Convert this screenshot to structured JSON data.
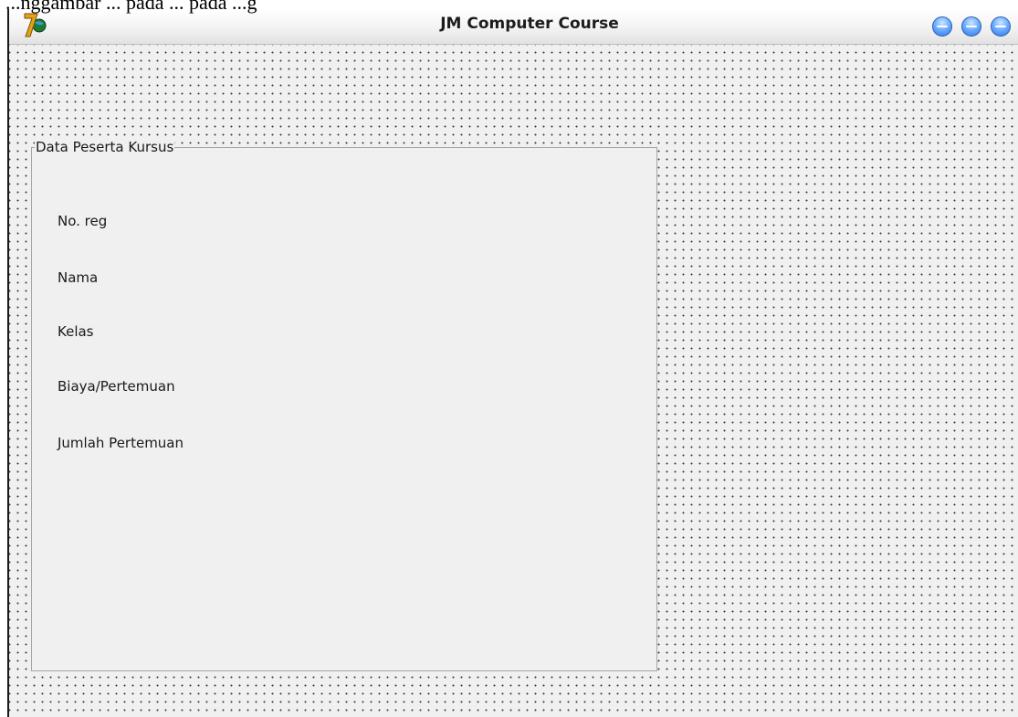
{
  "page_caption": "...nggambar ... pada ... pada ...g",
  "window": {
    "title": "JM Computer Course",
    "app_icon": "delphi-7-icon",
    "controls": [
      "minimize-button",
      "maximize-button",
      "close-button"
    ]
  },
  "groupbox": {
    "caption": "Data Peserta Kursus",
    "labels": [
      "No. reg",
      "Nama",
      "Kelas",
      "Biaya/Pertemuan",
      "Jumlah Pertemuan"
    ]
  },
  "colors": {
    "form_background": "#f0f0f0",
    "grid_dots": "#3d3d3d",
    "window_button": "#2d74e6"
  }
}
